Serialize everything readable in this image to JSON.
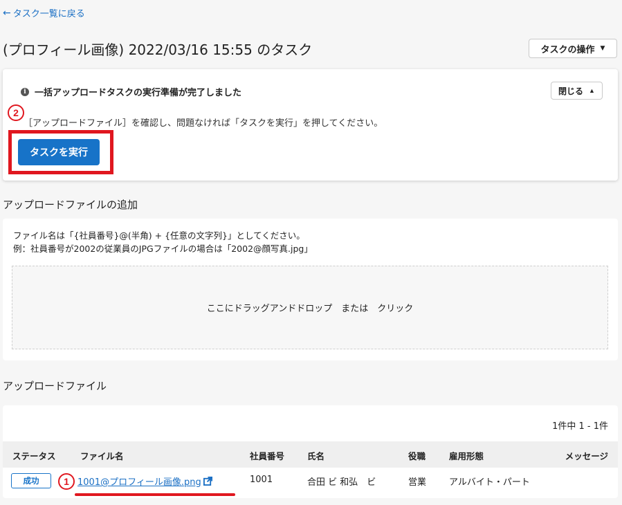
{
  "nav": {
    "back_label": "タスク一覧に戻る"
  },
  "header": {
    "title": "(プロフィール画像) 2022/03/16 15:55 のタスク",
    "task_ops_label": "タスクの操作"
  },
  "notice": {
    "heading": "一括アップロードタスクの実行準備が完了しました",
    "close_label": "閉じる",
    "body": "［アップロードファイル］を確認し、問題なければ「タスクを実行」を押してください。",
    "run_label": "タスクを実行",
    "marker": "2"
  },
  "upload": {
    "section_title": "アップロードファイルの追加",
    "hint_line1": "ファイル名は「{社員番号}@(半角) + {任意の文字列}」としてください。",
    "hint_line2": "例：社員番号が2002の従業員のJPGファイルの場合は「2002@顔写真.jpg」",
    "dropzone_text": "ここにドラッグアンドドロップ　または　クリック"
  },
  "files": {
    "section_title": "アップロードファイル",
    "count_text": "1件中 1 - 1件",
    "columns": [
      "ステータス",
      "ファイル名",
      "社員番号",
      "氏名",
      "役職",
      "雇用形態",
      "メッセージ"
    ],
    "rows": [
      {
        "status": "成功",
        "file_name": "1001@プロフィール画像.png",
        "employee_no": "1001",
        "name": "合田 ビ 和弘　ビ",
        "position": "営業",
        "employment": "アルバイト・パート",
        "message": ""
      }
    ],
    "marker": "1"
  },
  "colors": {
    "link": "#1a6fc4",
    "primary": "#1773c8",
    "annotation_red": "#e0171f"
  }
}
